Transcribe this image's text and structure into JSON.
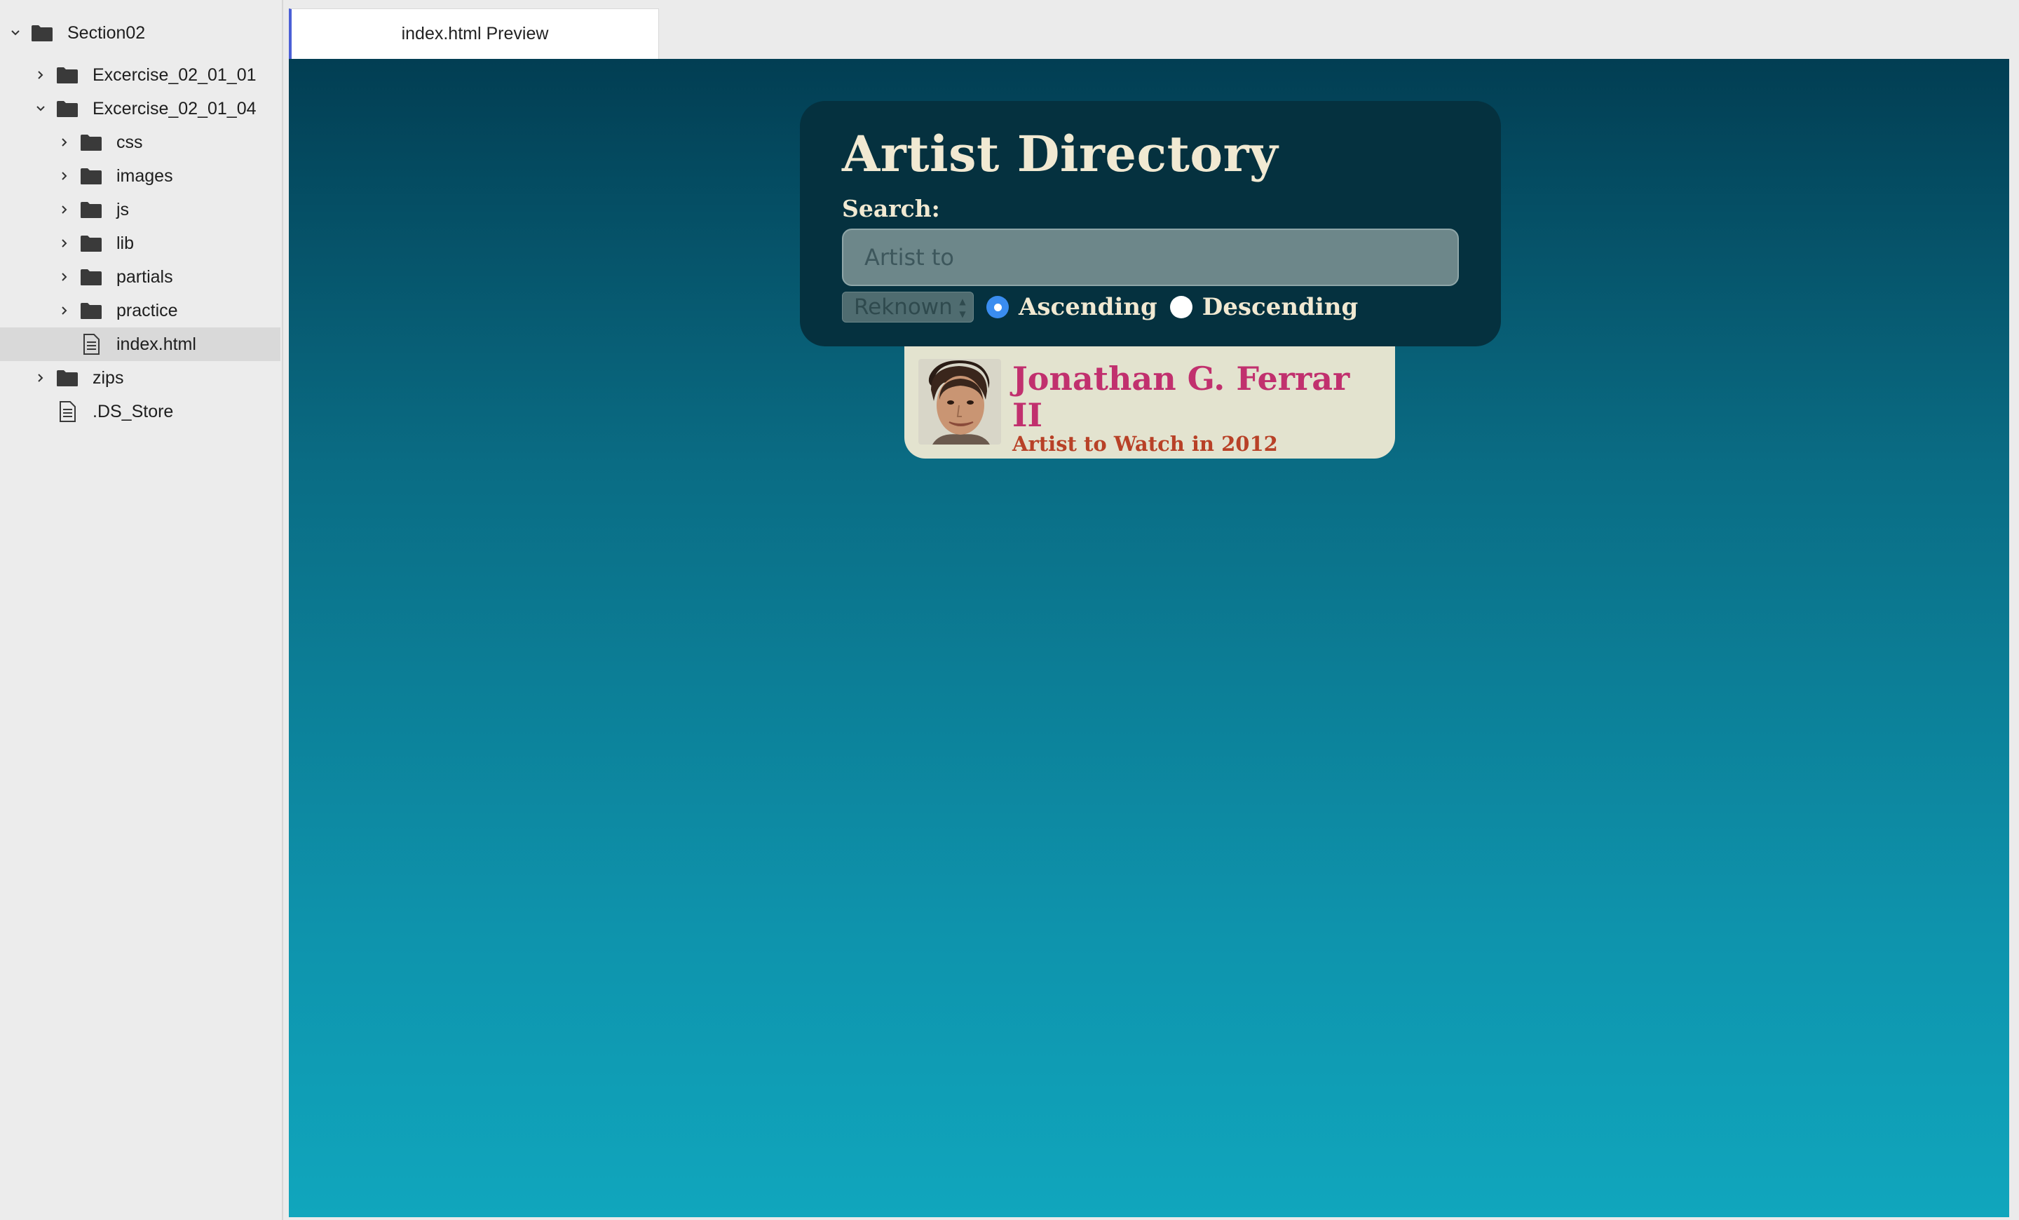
{
  "sidebar": {
    "items": [
      {
        "label": "Section02",
        "type": "folder",
        "expanded": true
      },
      {
        "label": "Excercise_02_01_01",
        "type": "folder",
        "expanded": false
      },
      {
        "label": "Excercise_02_01_04",
        "type": "folder",
        "expanded": true
      },
      {
        "label": "css",
        "type": "folder",
        "expanded": false
      },
      {
        "label": "images",
        "type": "folder",
        "expanded": false
      },
      {
        "label": "js",
        "type": "folder",
        "expanded": false
      },
      {
        "label": "lib",
        "type": "folder",
        "expanded": false
      },
      {
        "label": "partials",
        "type": "folder",
        "expanded": false
      },
      {
        "label": "practice",
        "type": "folder",
        "expanded": false
      },
      {
        "label": "index.html",
        "type": "file",
        "selected": true
      },
      {
        "label": "zips",
        "type": "folder",
        "expanded": false
      },
      {
        "label": ".DS_Store",
        "type": "file"
      }
    ]
  },
  "tabs": [
    {
      "label": "index.html Preview",
      "active": true
    }
  ],
  "preview": {
    "title": "Artist Directory",
    "search_label": "Search:",
    "search_value": "Artist to",
    "sort_select": "Reknown",
    "radio_ascending": "Ascending",
    "radio_descending": "Descending",
    "selected_order": "Ascending"
  },
  "results": [
    {
      "name": "Jonathan G. Ferrar II",
      "reknown": "Artist to Watch in 2012"
    }
  ],
  "colors": {
    "panel_bg": "#05313f",
    "title_text": "#f1e9d2",
    "name_color": "#c1306e",
    "reknown_color": "#b84127",
    "card_bg": "#e3e3cf",
    "radio_checked": "#3a8df0",
    "tab_accent": "#4a5fd6"
  }
}
